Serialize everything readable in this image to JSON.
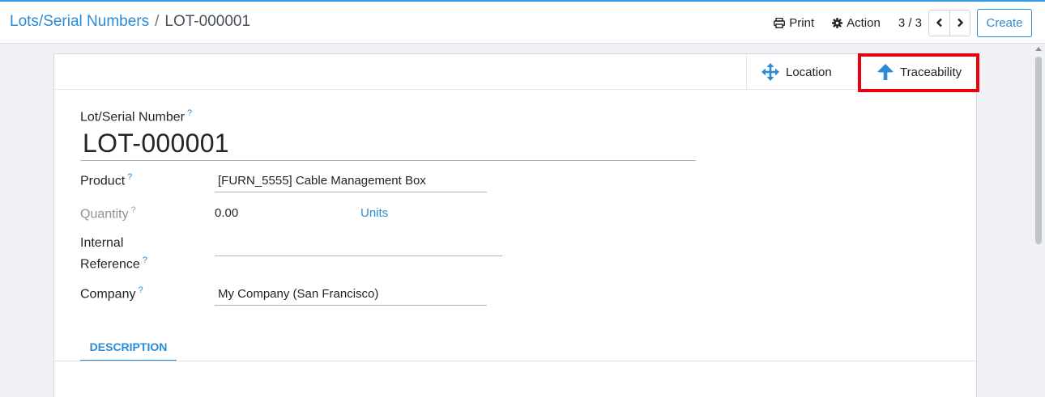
{
  "breadcrumb": {
    "parent": "Lots/Serial Numbers",
    "separator": "/",
    "current": "LOT-000001"
  },
  "toolbar": {
    "print_label": "Print",
    "action_label": "Action",
    "pager_value": "3 / 3",
    "create_label": "Create"
  },
  "stat_buttons": {
    "location_label": "Location",
    "traceability_label": "Traceability"
  },
  "form": {
    "title_label": "Lot/Serial Number",
    "title_value": "LOT-000001",
    "product": {
      "label": "Product",
      "value": "[FURN_5555] Cable Management Box"
    },
    "quantity": {
      "label": "Quantity",
      "value": "0.00",
      "unit": "Units"
    },
    "internal_reference": {
      "label_line1": "Internal",
      "label_line2": "Reference",
      "value": ""
    },
    "company": {
      "label": "Company",
      "value": "My Company (San Francisco)"
    },
    "help_mark": "?"
  },
  "tabs": [
    {
      "label": "DESCRIPTION"
    }
  ],
  "colors": {
    "accent": "#2c8bd5",
    "highlight": "#e8000f",
    "topbar": "#2c9be6"
  },
  "icons": {
    "print": "print-icon",
    "action": "gear-icon",
    "prev": "chevron-left-icon",
    "next": "chevron-right-icon",
    "location": "arrows-move-icon",
    "traceability": "arrow-up-icon"
  }
}
